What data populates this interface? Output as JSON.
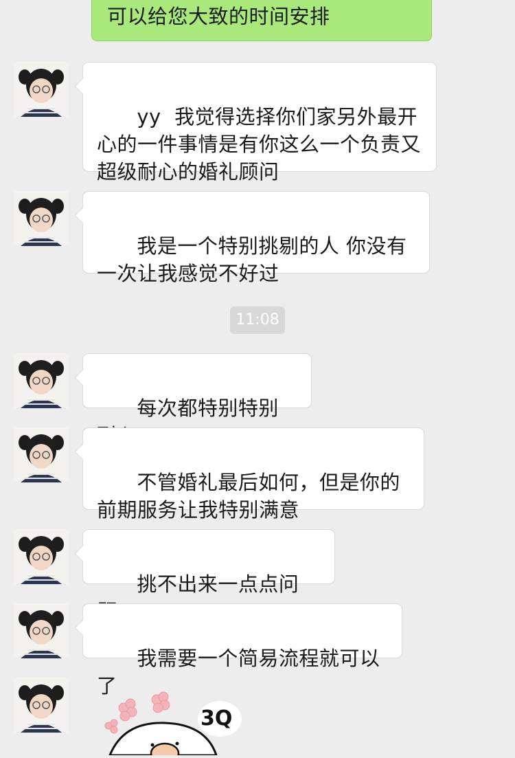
{
  "outgoing": {
    "text": "可以给您大致的时间安排"
  },
  "timestamp": "11:08",
  "messages": [
    {
      "text": "yy  我觉得选择你们家另外最开心的一件事情是有你这么一个负责又超级耐心的婚礼顾问"
    },
    {
      "text": "我是一个特别挑剔的人 你没有一次让我感觉不好过"
    },
    {
      "text": "每次都特别特别耐心"
    },
    {
      "text": "不管婚礼最后如何，但是你的前期服务让我特别满意"
    },
    {
      "text": "挑不出来一点点问题。"
    },
    {
      "text": "我需要一个简易流程就可以了"
    }
  ],
  "sticker": {
    "text": "3Q",
    "icon": "thank-you-sticker"
  }
}
